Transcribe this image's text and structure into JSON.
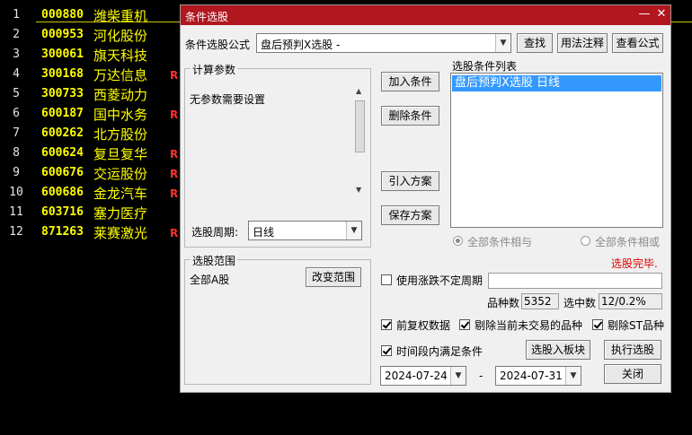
{
  "stocks": [
    {
      "index": "1",
      "code": "000880",
      "name": "潍柴重机",
      "flag": ""
    },
    {
      "index": "2",
      "code": "000953",
      "name": "河化股份",
      "flag": ""
    },
    {
      "index": "3",
      "code": "300061",
      "name": "旗天科技",
      "flag": ""
    },
    {
      "index": "4",
      "code": "300168",
      "name": "万达信息",
      "flag": "R"
    },
    {
      "index": "5",
      "code": "300733",
      "name": "西菱动力",
      "flag": ""
    },
    {
      "index": "6",
      "code": "600187",
      "name": "国中水务",
      "flag": "R"
    },
    {
      "index": "7",
      "code": "600262",
      "name": "北方股份",
      "flag": ""
    },
    {
      "index": "8",
      "code": "600624",
      "name": "复旦复华",
      "flag": "R"
    },
    {
      "index": "9",
      "code": "600676",
      "name": "交运股份",
      "flag": "R"
    },
    {
      "index": "10",
      "code": "600686",
      "name": "金龙汽车",
      "flag": "R"
    },
    {
      "index": "11",
      "code": "603716",
      "name": "塞力医疗",
      "flag": ""
    },
    {
      "index": "12",
      "code": "871263",
      "name": "莱赛激光",
      "flag": "R"
    }
  ],
  "dialog": {
    "title": "条件选股",
    "minimize": "—",
    "close": "✕",
    "formula_label": "条件选股公式",
    "formula_value": "盘后预判X选股 -",
    "find_button": "查找",
    "usage_button": "用法注释",
    "view_formula_button": "查看公式",
    "params_group_title": "计算参数",
    "params_text": "无参数需要设置",
    "period_label": "选股周期:",
    "period_value": "日线",
    "add_condition_button": "加入条件",
    "delete_condition_button": "删除条件",
    "import_plan_button": "引入方案",
    "save_plan_button": "保存方案",
    "condition_list_title": "选股条件列表",
    "condition_list": [
      "盘后预判X选股  日线"
    ],
    "radio_and_label": "全部条件相与",
    "radio_or_label": "全部条件相或",
    "status_text": "选股完毕.",
    "range_group_title": "选股范围",
    "range_value": "全部A股",
    "change_range_button": "改变范围",
    "variable_period_label": "使用涨跌不定周期",
    "count_label": "品种数",
    "count_value": "5352",
    "selected_label": "选中数",
    "selected_value": "12/0.2%",
    "pre_adjust_label": "前复权数据",
    "exclude_untraded_label": "剔除当前未交易的品种",
    "exclude_st_label": "剔除ST品种",
    "time_condition_label": "时间段内满足条件",
    "to_block_button": "选股入板块",
    "execute_button": "执行选股",
    "date_from": "2024-07-24",
    "date_sep": "-",
    "date_to": "2024-07-31",
    "close_button": "关闭"
  },
  "colors": {
    "title_bar": "#b0171f",
    "stock_text": "#ffff00",
    "flag": "#ff3030",
    "status": "#e00000",
    "selection": "#3399ff"
  }
}
